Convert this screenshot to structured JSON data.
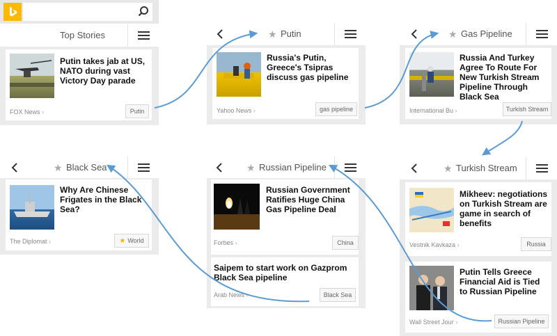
{
  "screens": {
    "top_stories": {
      "title": "Top Stories",
      "card": {
        "headline": "Putin takes jab at US, NATO during vast Victory Day parade",
        "source": "FOX News",
        "tag": "Putin"
      }
    },
    "putin": {
      "title": "Putin",
      "card": {
        "headline": "Russia's Putin, Greece's Tsipras discuss gas pipeline",
        "source": "Yahoo News",
        "tag": "gas pipeline"
      }
    },
    "gas_pipeline": {
      "title": "Gas Pipeline",
      "card": {
        "headline": "Russia And Turkey Agree To Route For New Turkish Stream Pipeline Through Black Sea",
        "source": "International Bu",
        "tag": "Turkish Stream"
      }
    },
    "black_sea": {
      "title": "Black Sea",
      "card": {
        "headline": "Why Are Chinese Frigates in the Black Sea?",
        "source": "The Diplomat",
        "tag": "World"
      }
    },
    "russian_pipeline": {
      "title": "Russian Pipeline",
      "card1": {
        "headline": "Russian Government Ratifies Huge China Gas Pipeline Deal",
        "source": "Forbes",
        "tag": "China"
      },
      "card2": {
        "headline": "Saipem to start work on Gazprom Black Sea pipeline",
        "source": "Arab News",
        "tag": "Black Sea"
      }
    },
    "turkish_stream": {
      "title": "Turkish Stream",
      "card1": {
        "headline": "Mikheev: negotiations on Turkish Stream are game in search of benefits",
        "source": "Vestnik Kavkaza",
        "tag": "Russia"
      },
      "card2": {
        "headline": "Putin Tells Greece Financial Aid is Tied to Russian Pipeline",
        "source": "Wall Street Jour",
        "tag": "Russian Pipeline"
      }
    }
  },
  "colors": {
    "bing_orange": "#ffb900",
    "arrow_blue": "#5b9bd5",
    "panel_gray": "#ebebeb"
  },
  "icons": [
    "bing-logo-icon",
    "search-icon",
    "back-icon",
    "star-icon",
    "menu-icon"
  ]
}
